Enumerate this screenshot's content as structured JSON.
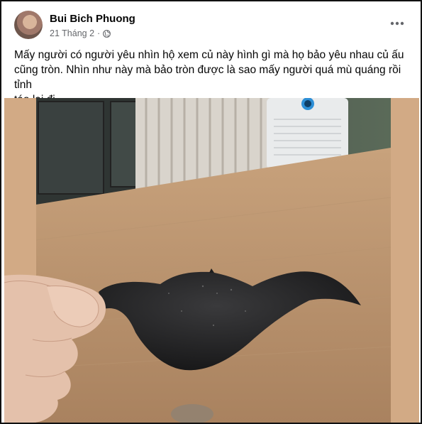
{
  "post": {
    "author": "Bui Bich Phuong",
    "date": "21 Tháng 2",
    "separator": "·",
    "privacy_icon": "globe-icon",
    "more_icon": "more-options-icon",
    "text_line_1": "Mấy người có người yêu nhìn hộ xem củ này hình gì mà họ bảo yêu nhau củ ấu",
    "text_line_2": "cũng tròn. Nhìn như này mà bảo tròn được là sao mấy người quá mù quáng rồi tỉnh",
    "text_line_3": "táo lại đi"
  },
  "colors": {
    "text": "#050505",
    "secondary_text": "#65676b",
    "photo_side_bars": "#d2aa85"
  }
}
